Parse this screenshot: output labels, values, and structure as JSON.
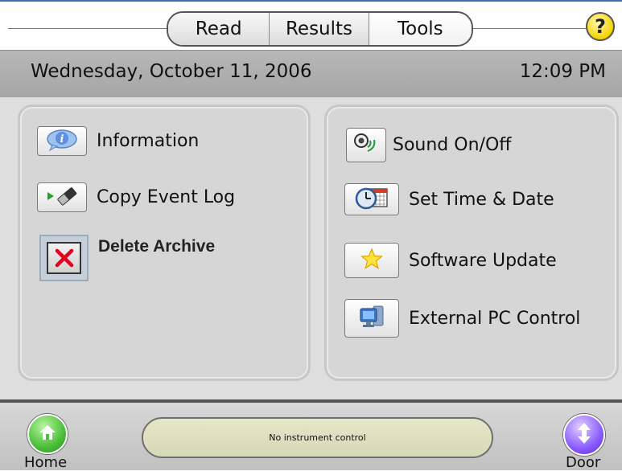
{
  "tabs": [
    {
      "label": "Read",
      "selected": false
    },
    {
      "label": "Results",
      "selected": false
    },
    {
      "label": "Tools",
      "selected": true
    }
  ],
  "help": {
    "label": "?"
  },
  "datebar": {
    "date": "Wednesday, October 11, 2006",
    "time": "12:09 PM"
  },
  "left_panel": {
    "items": [
      {
        "label": "Information",
        "icon": "info-icon"
      },
      {
        "label": "Copy Event Log",
        "icon": "usb-drive-icon"
      },
      {
        "label": "Delete Archive",
        "icon": "delete-x-icon"
      }
    ]
  },
  "right_panel": {
    "items": [
      {
        "label": "Sound On/Off",
        "icon": "speaker-icon"
      },
      {
        "label": "Set Time & Date",
        "icon": "clock-calendar-icon"
      },
      {
        "label": "Software Update",
        "icon": "star-icon"
      },
      {
        "label": "External PC Control",
        "icon": "computer-icon"
      }
    ]
  },
  "bottom": {
    "home_label": "Home",
    "door_label": "Door",
    "status": "No instrument control"
  },
  "colors": {
    "accent_line": "#3d6fb6",
    "help_yellow": "#f4d400",
    "home_green": "#4cbf3a",
    "door_purple": "#8a5cff",
    "delete_red": "#e3001b",
    "status_bg": "#dfe1c1"
  }
}
